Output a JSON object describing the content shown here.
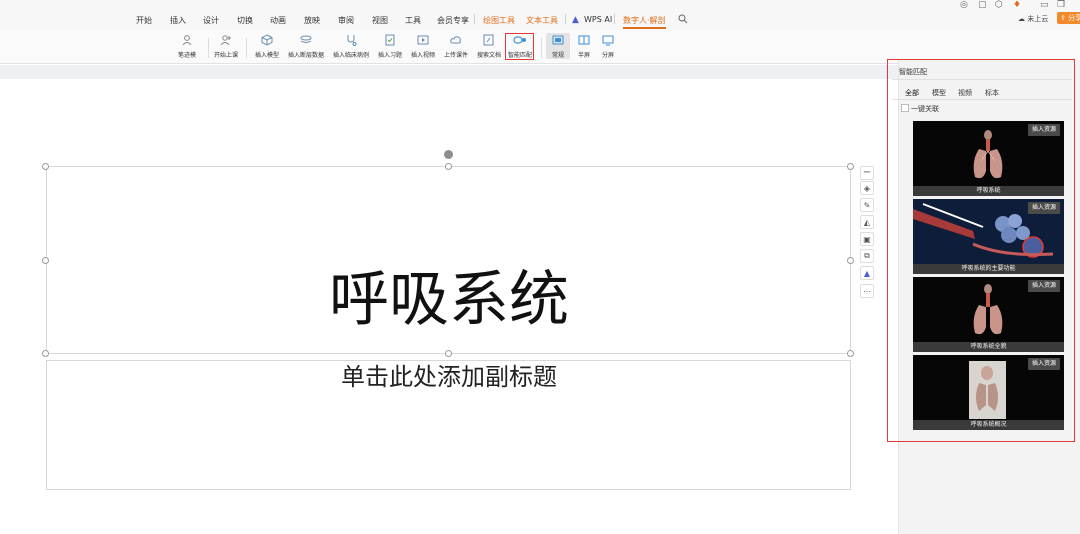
{
  "menubar": {
    "tabs": [
      "开始",
      "插入",
      "设计",
      "切换",
      "动画",
      "放映",
      "审阅",
      "视图",
      "工具",
      "会员专享",
      "绘图工具",
      "文本工具",
      "WPS AI",
      "数字人·解剖"
    ],
    "cloud_label": "未上云",
    "share_label": "分享"
  },
  "ribbon": {
    "tools": [
      "笔迹模",
      "开始上课",
      "插入模型",
      "插入断层数据",
      "插入临床病例",
      "插入习题",
      "插入视频",
      "上传课件",
      "搜索文档",
      "智能匹配",
      "常规",
      "半屏",
      "分屏"
    ]
  },
  "slide": {
    "title": "呼吸系统",
    "subtitle": "单击此处添加副标题"
  },
  "panel": {
    "title": "智能匹配",
    "tabs": [
      "全部",
      "模型",
      "视频",
      "标本"
    ],
    "checkbox_label": "一键关联",
    "insert_label": "插入资源",
    "cards": [
      {
        "caption": "呼吸系统"
      },
      {
        "caption": "呼吸系统的主要功能"
      },
      {
        "caption": "呼吸系统全貌"
      },
      {
        "caption": "呼吸系统概况"
      }
    ]
  },
  "colors": {
    "accent": "#e06e17",
    "highlight_red": "#e53935",
    "card_background": "#050505"
  }
}
